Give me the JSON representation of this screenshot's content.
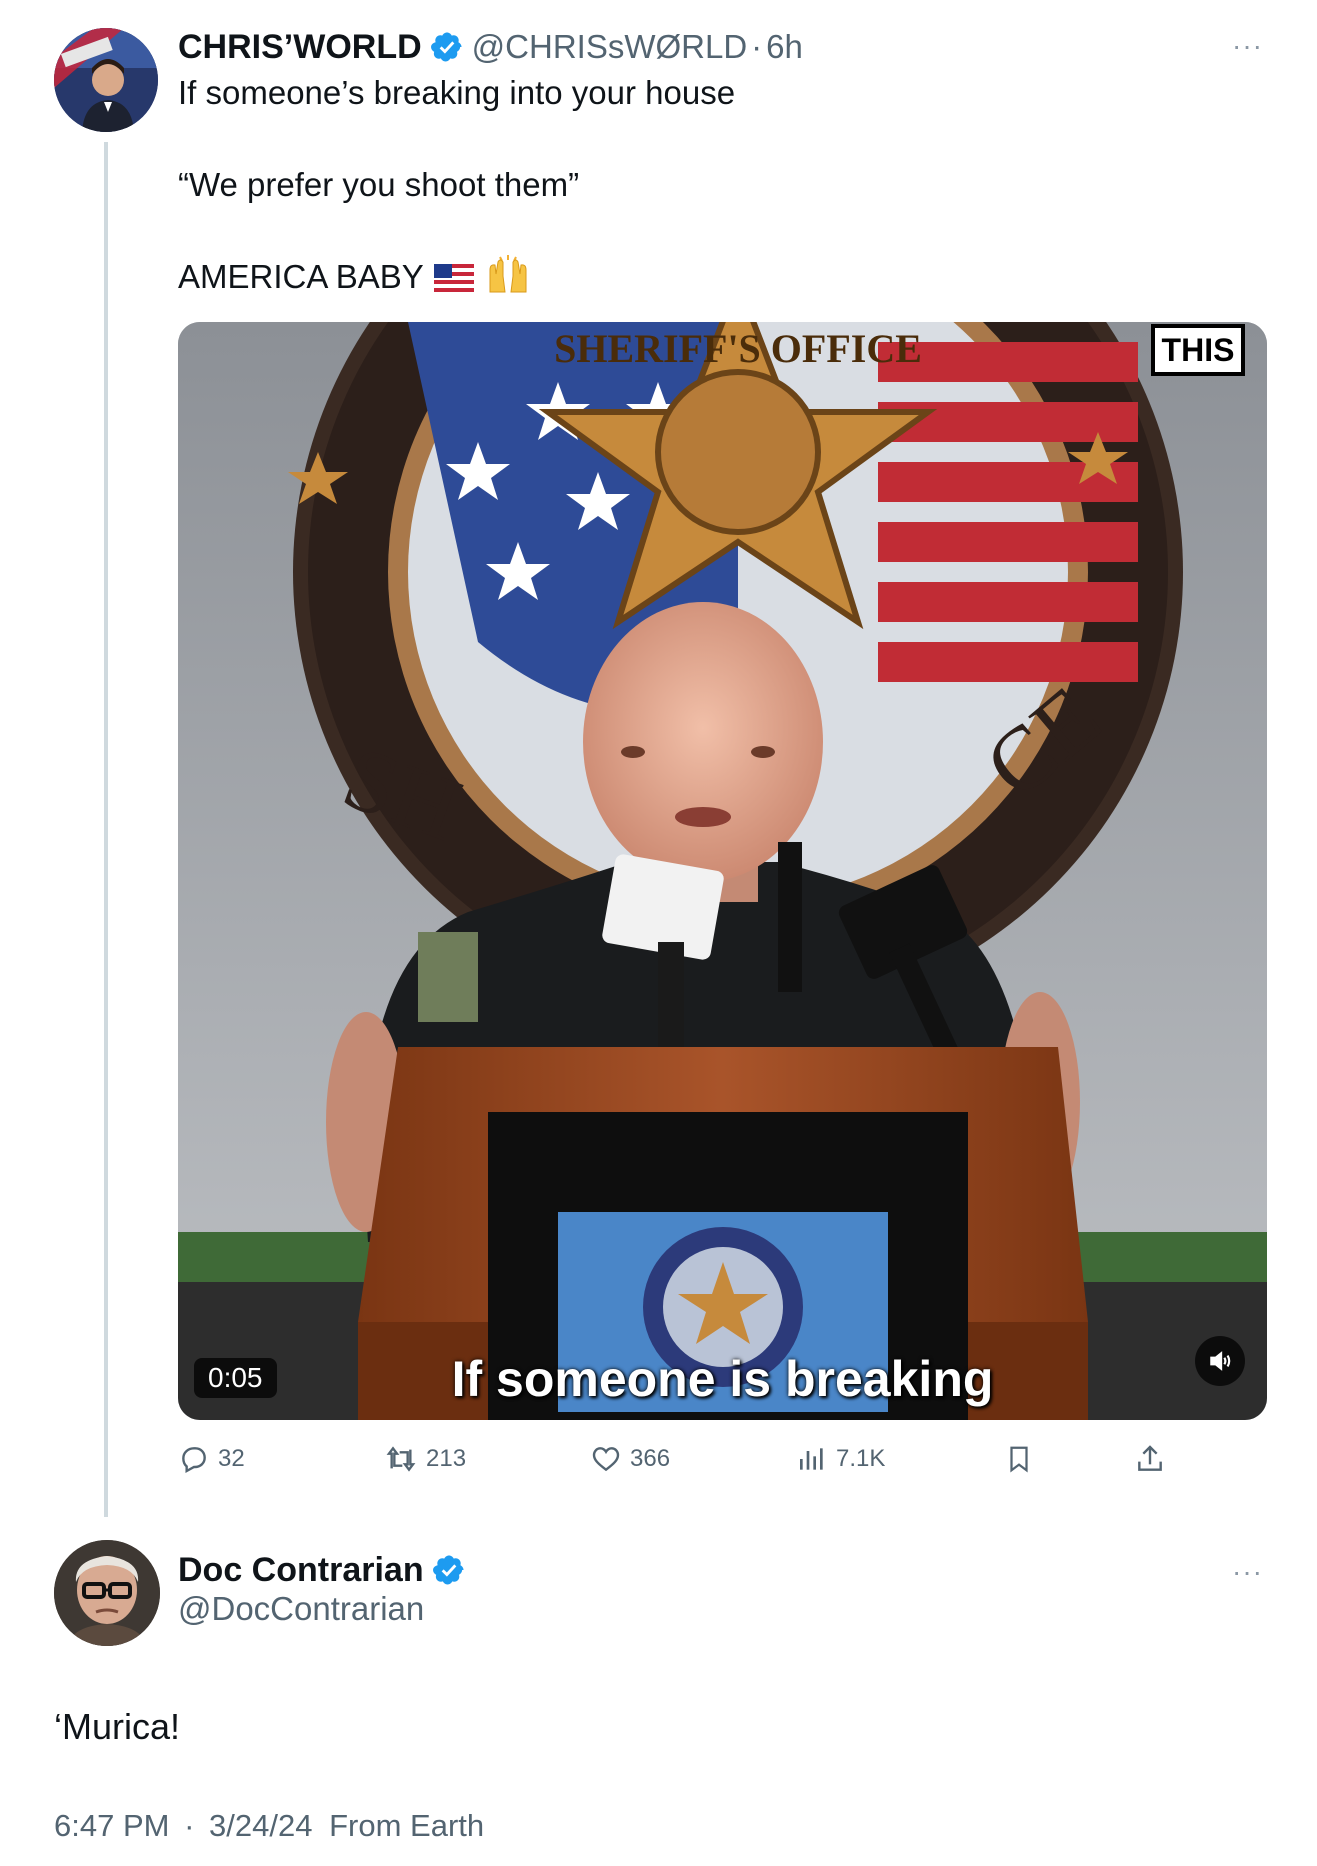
{
  "tweet": {
    "display_name": "CHRIS’WORLD",
    "handle": "@CHRISsWØRLD",
    "separator": "·",
    "time_ago": "6h",
    "more": "···",
    "lines": [
      "If someone’s breaking into your house",
      "“We prefer you shoot them”",
      "AMERICA BABY"
    ],
    "emojis": [
      "us-flag",
      "raising-hands"
    ],
    "media": {
      "type": "video",
      "timestamp": "0:05",
      "caption": "If someone is breaking",
      "badge": "THIS",
      "mute_icon": "speaker-muted-icon"
    },
    "actions": {
      "replies": "32",
      "reposts": "213",
      "likes": "366",
      "views": "7.1K"
    }
  },
  "reply": {
    "display_name": "Doc Contrarian",
    "handle": "@DocContrarian",
    "more": "···",
    "text": "‘Murica!",
    "time": "6:47 PM",
    "separator": "·",
    "date": "3/24/24",
    "source": "From Earth"
  },
  "colors": {
    "verified": "#1d9bf0",
    "secondary_text": "#536471",
    "thread_line": "#cfd9de"
  }
}
